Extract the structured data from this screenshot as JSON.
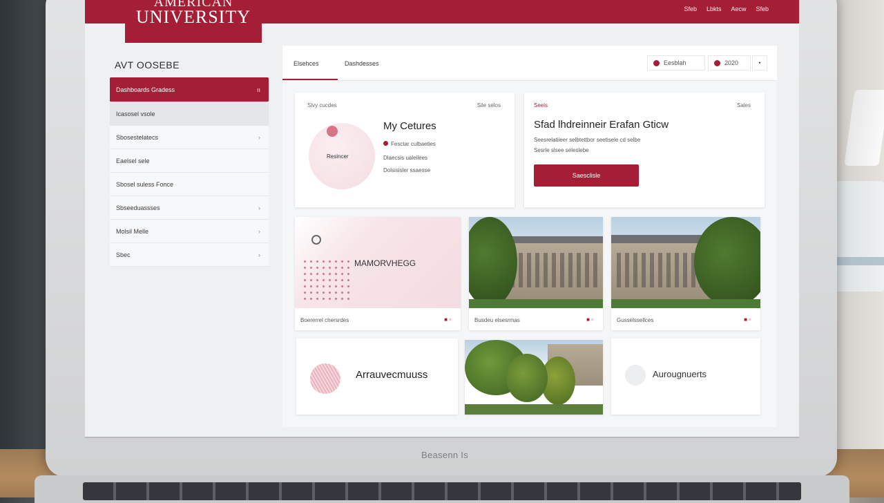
{
  "header": {
    "logo_top": "AMERICAN",
    "logo_bottom": "UNIVERSITY",
    "nav": [
      "Sfeb",
      "Lbkts",
      "Aecw",
      "Sfeb"
    ]
  },
  "sidebar": {
    "title": "AVT OOSEBE",
    "items": [
      {
        "label": "Dashboards Gradess",
        "chevron": "ıı"
      },
      {
        "label": "Icasosel vsole",
        "chevron": ""
      },
      {
        "label": "Sbosestelatecs",
        "chevron": "›"
      },
      {
        "label": "Eaelsel sele",
        "chevron": ""
      },
      {
        "label": "Sbosel suless Fonce",
        "chevron": ""
      },
      {
        "label": "Sbseeduassses",
        "chevron": "›"
      },
      {
        "label": "Molsil Melle",
        "chevron": "›"
      },
      {
        "label": "Sbec",
        "chevron": "›"
      }
    ]
  },
  "tabs": {
    "items": [
      "Elsehces",
      "Dashdesses"
    ]
  },
  "filters": {
    "first": "Eesblah",
    "second": "2020",
    "more": "•"
  },
  "card_courses": {
    "head_left": "Slvy cucdes",
    "head_right": "Sile selos",
    "circle_label": "Resincer",
    "title": "My Cetures",
    "lines": [
      "Fesctar culbaeties",
      "Dlaecsis ualeilees",
      "Dolsisisler ssaesse"
    ]
  },
  "card_feature": {
    "head_left": "Seeis",
    "head_right": "Sales",
    "title": "Sfad lhdreinneir Erafan Gticw",
    "lines": [
      "Seesrelatiieer selbtettbor seetisele cd selbe",
      "Sesrle slsee seleslebe"
    ],
    "button": "Saesclisle"
  },
  "tiles_row1": [
    {
      "label": "MAMORVHEGG",
      "caption": "Boererrel chersrdes",
      "icons": "■ ▫"
    },
    {
      "label": "",
      "caption": "Busdeu elsesrmas",
      "icons": "■ ▫"
    },
    {
      "label": "",
      "caption": "Gusselssellces",
      "icons": "■ ▫"
    }
  ],
  "tiles_row2": [
    {
      "label": "Arrauvecmuuss"
    },
    {
      "label": ""
    },
    {
      "label": "Aurougnuerts"
    }
  ],
  "laptop": {
    "brand": "Beasenn Is"
  },
  "colors": {
    "brand_red": "#a41e36",
    "panel": "#f5f6f7"
  }
}
